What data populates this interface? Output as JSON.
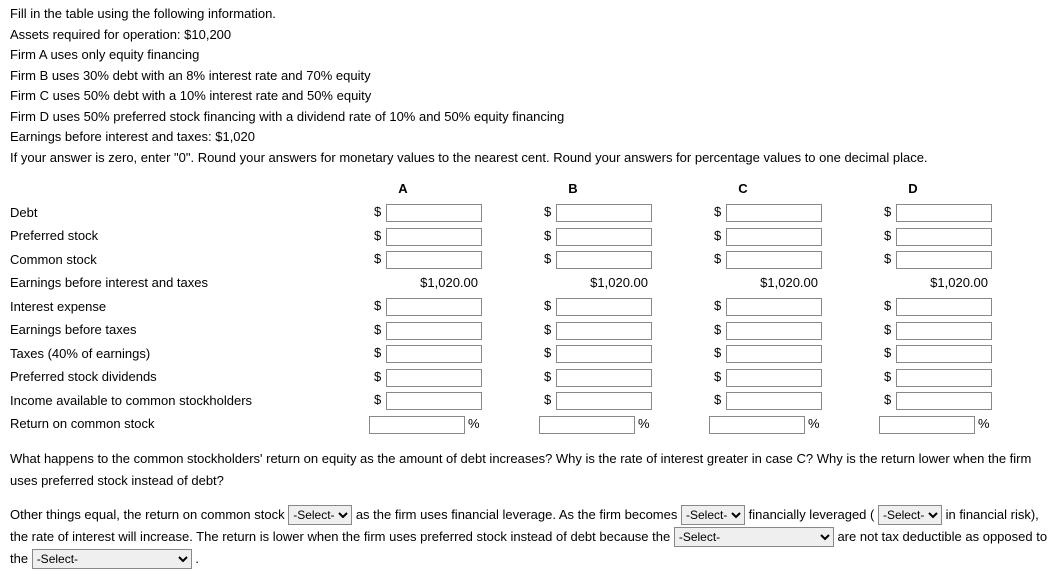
{
  "intro": [
    "Fill in the table using the following information.",
    "Assets required for operation: $10,200",
    "Firm A uses only equity financing",
    "Firm B uses 30% debt with an 8% interest rate and 70% equity",
    "Firm C uses 50% debt with a 10% interest rate and 50% equity",
    "Firm D uses 50% preferred stock financing with a dividend rate of 10% and 50% equity financing",
    "Earnings before interest and taxes: $1,020",
    "If your answer is zero, enter \"0\". Round your answers for monetary values to the nearest cent. Round your answers for percentage values to one decimal place."
  ],
  "cols": {
    "A": "A",
    "B": "B",
    "C": "C",
    "D": "D"
  },
  "rows": {
    "debt": "Debt",
    "pref": "Preferred stock",
    "common": "Common stock",
    "ebit": "Earnings before interest and taxes",
    "iexp": "Interest expense",
    "ebt": "Earnings before taxes",
    "tax": "Taxes (40% of earnings)",
    "pdiv": "Preferred stock dividends",
    "inc": "Income available to common stockholders",
    "roe": "Return on common stock"
  },
  "ebit_val": "$1,020.00",
  "q": "What happens to the common stockholders' return on equity as the amount of debt increases? Why is the rate of interest greater in case C? Why is the return lower when the firm uses preferred stock instead of debt?",
  "ans": {
    "p1": "Other things equal, the return on common stock ",
    "p2": " as the firm uses financial leverage. As the firm becomes ",
    "p3": " financially leveraged (",
    "p4": " in financial risk), the rate of interest will increase. The return is lower when the firm uses preferred stock instead of debt because the ",
    "p5": " are not tax deductible as opposed to the ",
    "p6": " ."
  },
  "sel_placeholder": "-Select-",
  "dollar": "$",
  "percent": "%"
}
